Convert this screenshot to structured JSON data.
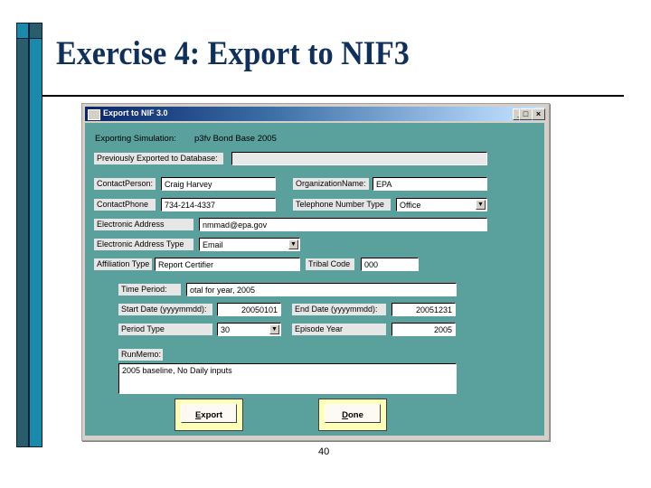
{
  "slide": {
    "title": "Exercise 4: Export to NIF3",
    "page_number": "40"
  },
  "window": {
    "title": "Export to NIF 3.0",
    "controls": {
      "minimize": "_",
      "maximize": "□",
      "close": "×"
    }
  },
  "form": {
    "exporting_label": "Exporting Simulation:",
    "exporting_value": "p3fv Bond Base 2005",
    "prev_exported_label": "Previously Exported to Database:",
    "prev_exported_value": "",
    "contact_person_label": "ContactPerson:",
    "contact_person_value": "Craig Harvey",
    "organization_label": "OrganizationName:",
    "organization_value": "EPA",
    "contact_phone_label": "ContactPhone",
    "contact_phone_value": "734-214-4337",
    "phone_type_label": "Telephone Number Type",
    "phone_type_value": "Office",
    "electronic_address_label": "Electronic Address",
    "electronic_address_value": "nmmad@epa.gov",
    "electronic_address_type_label": "Electronic Address Type",
    "electronic_address_type_value": "Email",
    "affiliation_type_label": "Affiliation Type",
    "affiliation_type_value": "Report Certifier",
    "tribal_code_label": "Tribal Code",
    "tribal_code_value": "000",
    "time_period_label": "Time Period:",
    "time_period_value": "otal for year, 2005",
    "start_date_label": "Start Date (yyyymmdd):",
    "start_date_value": "20050101",
    "end_date_label": "End Date (yyyymmdd):",
    "end_date_value": "20051231",
    "period_type_label": "Period Type",
    "period_type_value": "30",
    "episode_year_label": "Episode Year",
    "episode_year_value": "2005",
    "run_memo_label": "RunMemo:",
    "run_memo_value": "2005 baseline, No Daily inputs",
    "dropdown_glyph": "▼"
  },
  "buttons": {
    "export_accel": "E",
    "export_rest": "xport",
    "done_accel": "D",
    "done_rest": "one"
  }
}
